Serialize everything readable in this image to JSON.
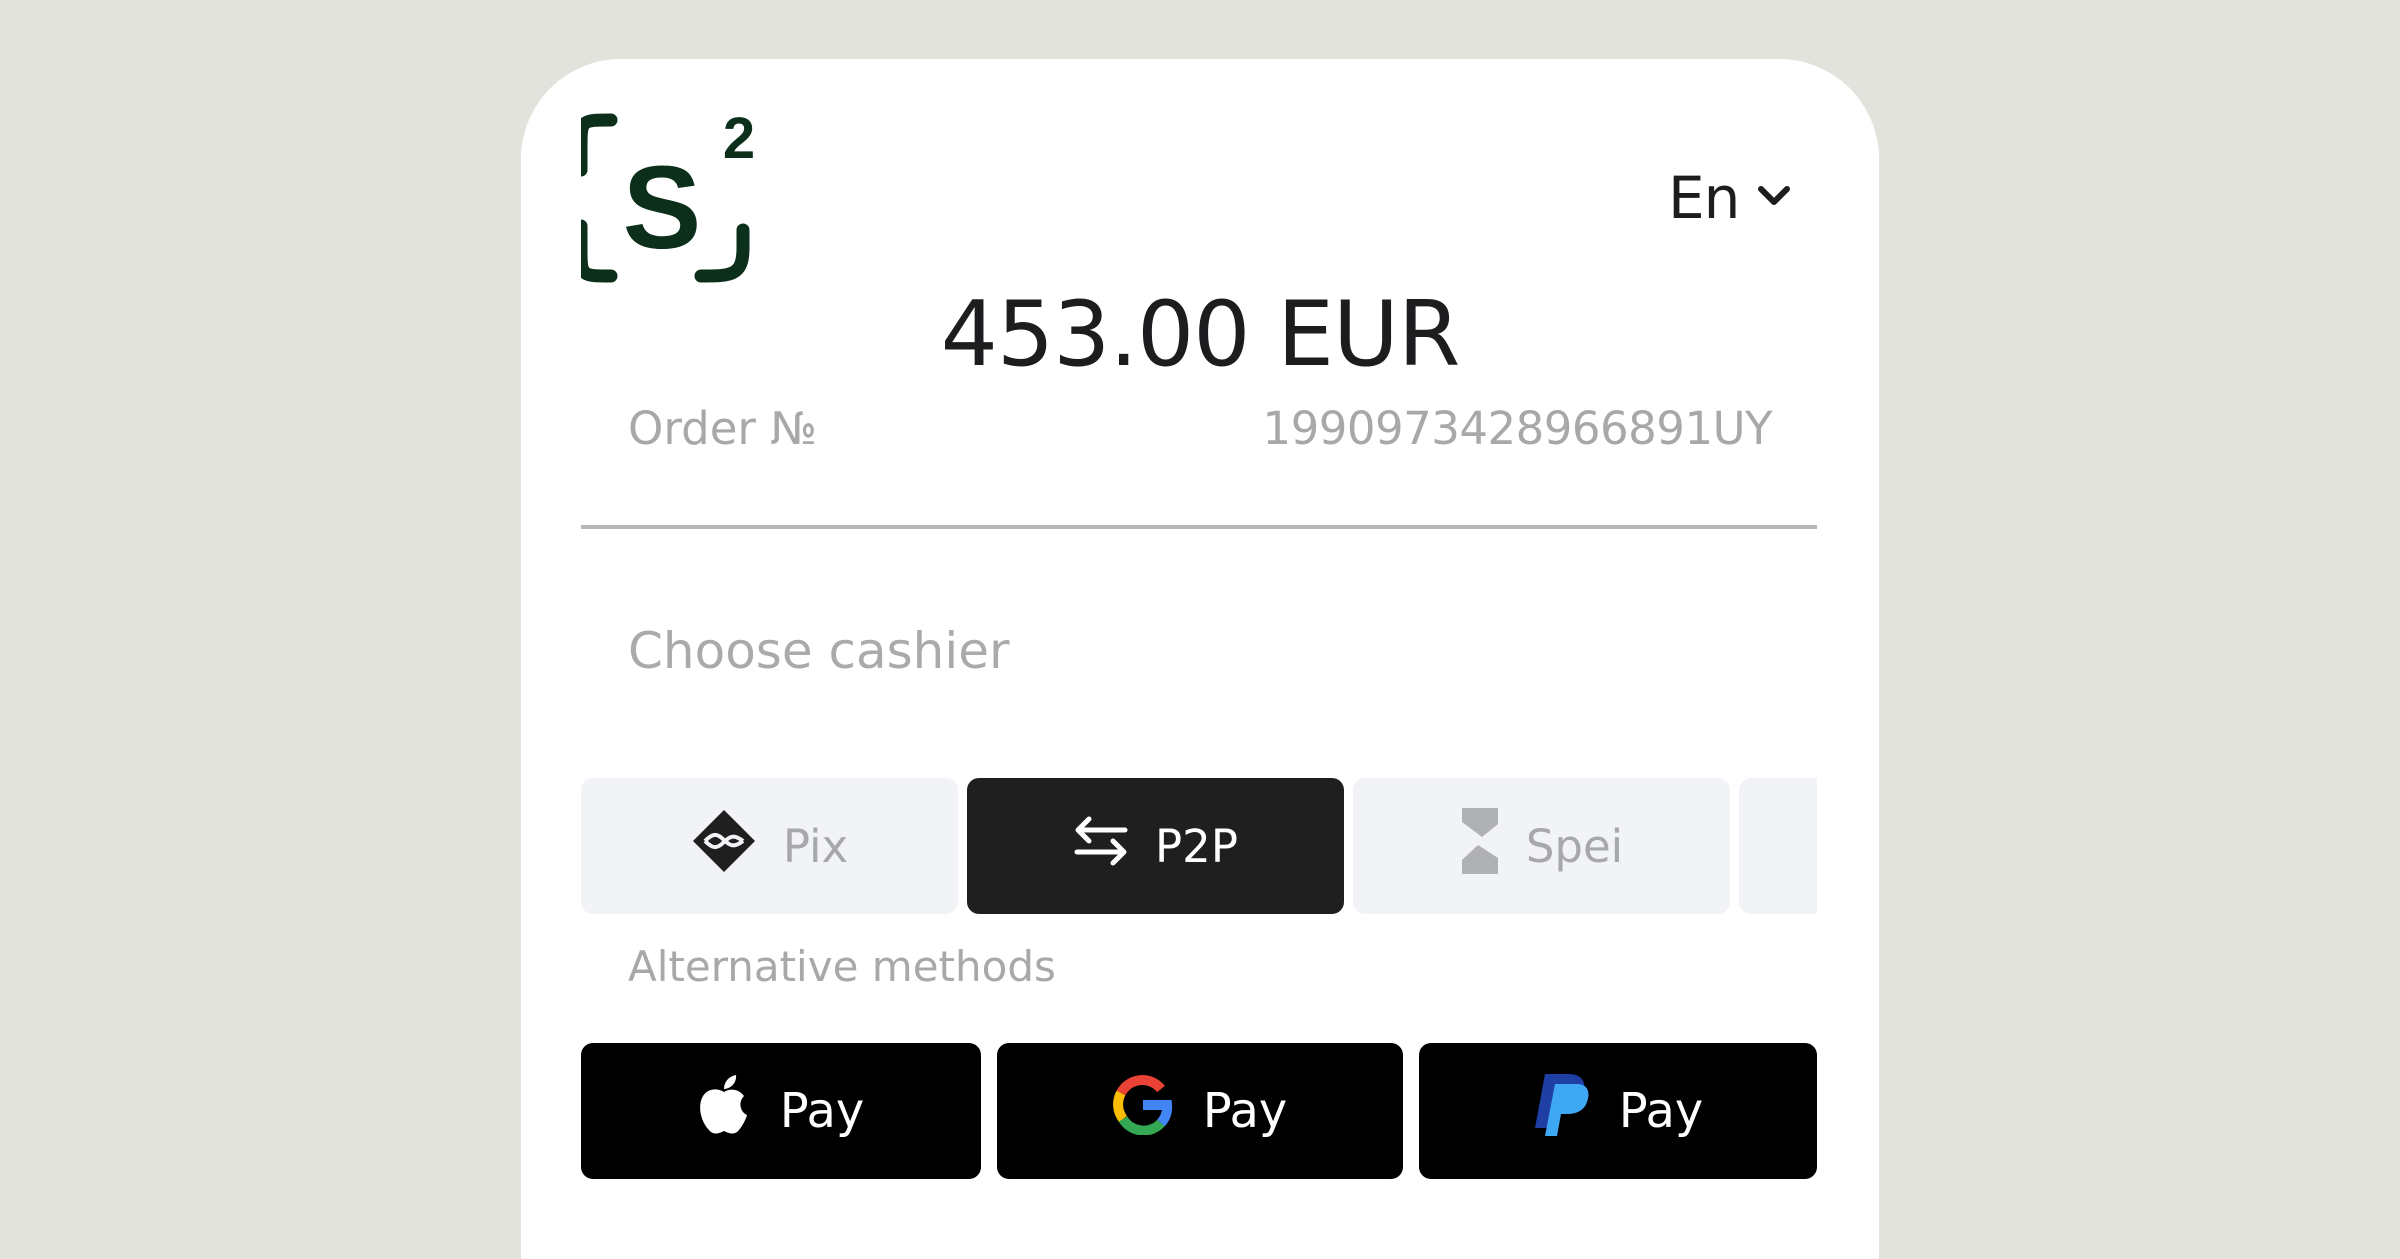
{
  "brand": {
    "logo_text": "S",
    "logo_superscript": "2",
    "logo_color": "#0c2f1b"
  },
  "language": {
    "selected": "En"
  },
  "order": {
    "amount": "453.00 EUR",
    "number_label": "Order №",
    "number_value": "1990973428966891UY"
  },
  "cashier": {
    "heading": "Choose cashier",
    "methods": [
      {
        "label": "Pix",
        "icon": "pix-icon",
        "active": false
      },
      {
        "label": "P2P",
        "icon": "transfer-arrows-icon",
        "active": true
      },
      {
        "label": "Spei",
        "icon": "spei-icon",
        "active": false
      }
    ]
  },
  "alternative": {
    "heading": "Alternative methods",
    "buttons": [
      {
        "label": "Pay",
        "icon": "apple-icon"
      },
      {
        "label": "Pay",
        "icon": "google-icon"
      },
      {
        "label": "Pay",
        "icon": "paypal-icon"
      }
    ]
  },
  "colors": {
    "background": "#e2e3dc",
    "active_method": "#1f1f1f",
    "inactive_method": "#f2f3f7",
    "muted_text": "#a7a8aa"
  }
}
